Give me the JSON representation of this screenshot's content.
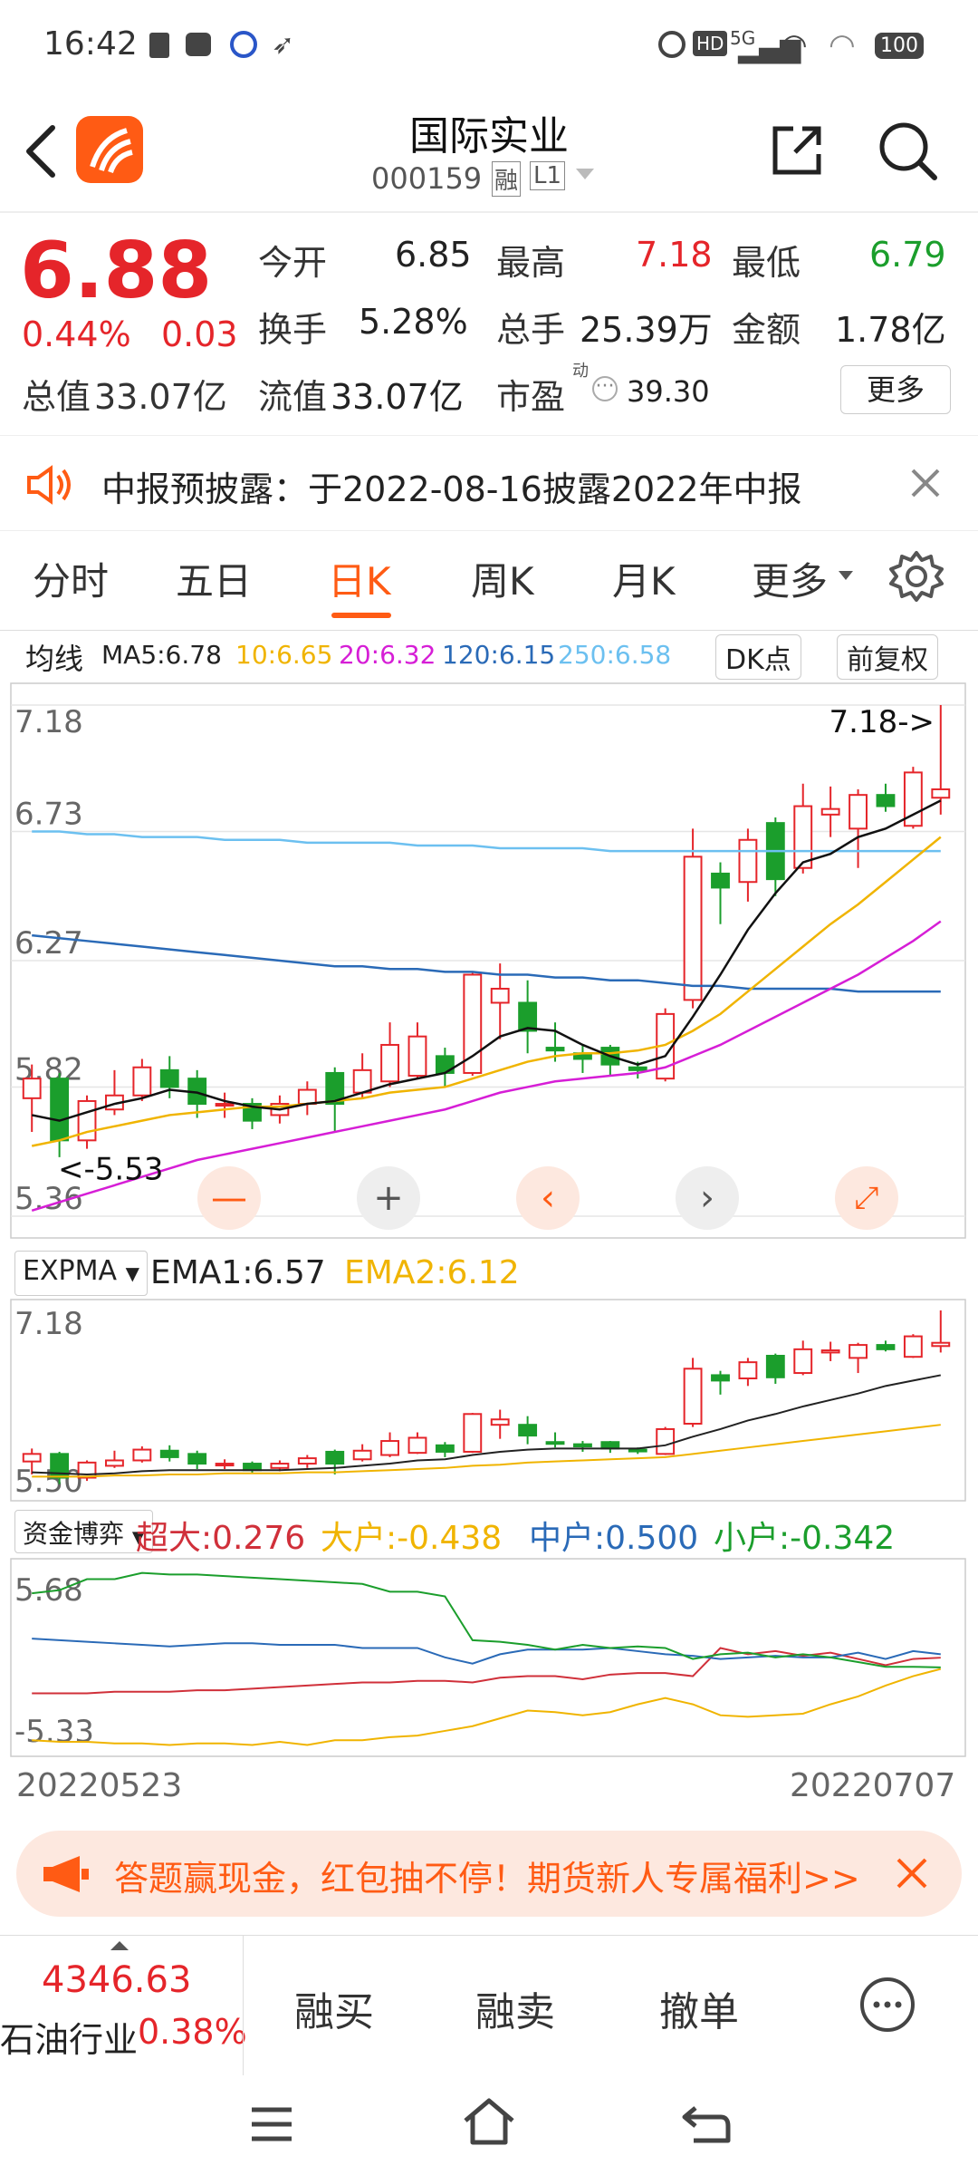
{
  "status_bar": {
    "time": "16:42",
    "network": "5G",
    "battery": "100"
  },
  "header": {
    "title": "国际实业",
    "code": "000159",
    "tag_rong": "融",
    "tag_level": "L1"
  },
  "quote": {
    "price": "6.88",
    "change_pct": "0.44%",
    "change": "0.03",
    "open_label": "今开",
    "open": "6.85",
    "high_label": "最高",
    "high": "7.18",
    "low_label": "最低",
    "low": "6.79",
    "turnover_label": "换手",
    "turnover": "5.28%",
    "volume_label": "总手",
    "volume": "25.39万",
    "amount_label": "金额",
    "amount": "1.78亿",
    "mktcap_label": "总值",
    "mktcap": "33.07亿",
    "float_label": "流值",
    "float": "33.07亿",
    "pe_label": "市盈",
    "pe_sup": "动",
    "pe": "39.30",
    "more_label": "更多"
  },
  "notice": {
    "text": "中报预披露：于2022-08-16披露2022年中报"
  },
  "tabs": [
    "分时",
    "五日",
    "日K",
    "周K",
    "月K",
    "更多"
  ],
  "ma_bar": {
    "label": "均线",
    "ma5": "MA5:6.78",
    "ma10": "10:6.65",
    "ma20": "20:6.32",
    "ma120": "120:6.15",
    "ma250": "250:6.58",
    "dk_label": "DK点",
    "adjust_label": "前复权"
  },
  "colors": {
    "up": "#e5252a",
    "down": "#1b9e2c",
    "accent": "#ff5b14",
    "ma5": "#111111",
    "ma10": "#f0b400",
    "ma20": "#d61ed6",
    "ma120": "#2a6ab7",
    "ma250": "#6cc0f0"
  },
  "chart_data": [
    {
      "type": "candlestick",
      "title": "日K",
      "x_start": "20220523",
      "x_end": "20220707",
      "ylim": [
        5.36,
        7.18
      ],
      "y_ticks": [
        "7.18",
        "6.73",
        "6.27",
        "5.82",
        "5.36"
      ],
      "max_marker": "7.18->",
      "min_marker": "5.53",
      "candles": [
        [
          5.78,
          5.85,
          5.9,
          5.66
        ],
        [
          5.85,
          5.63,
          5.87,
          5.57
        ],
        [
          5.63,
          5.77,
          5.79,
          5.6
        ],
        [
          5.74,
          5.79,
          5.88,
          5.72
        ],
        [
          5.79,
          5.89,
          5.92,
          5.77
        ],
        [
          5.88,
          5.82,
          5.93,
          5.78
        ],
        [
          5.85,
          5.76,
          5.88,
          5.71
        ],
        [
          5.76,
          5.76,
          5.8,
          5.71
        ],
        [
          5.76,
          5.7,
          5.78,
          5.67
        ],
        [
          5.72,
          5.76,
          5.79,
          5.69
        ],
        [
          5.76,
          5.81,
          5.84,
          5.72
        ],
        [
          5.87,
          5.76,
          5.89,
          5.66
        ],
        [
          5.8,
          5.88,
          5.94,
          5.78
        ],
        [
          5.84,
          5.97,
          6.05,
          5.82
        ],
        [
          5.86,
          6.0,
          6.05,
          5.85
        ],
        [
          5.93,
          5.87,
          5.96,
          5.82
        ],
        [
          5.87,
          6.22,
          6.23,
          5.86
        ],
        [
          6.12,
          6.17,
          6.26,
          5.99
        ],
        [
          6.12,
          6.02,
          6.2,
          5.94
        ],
        [
          5.96,
          5.95,
          6.05,
          5.91
        ],
        [
          5.94,
          5.92,
          5.97,
          5.87
        ],
        [
          5.96,
          5.9,
          5.97,
          5.86
        ],
        [
          5.89,
          5.88,
          5.91,
          5.85
        ],
        [
          5.85,
          6.08,
          6.1,
          5.84
        ],
        [
          6.13,
          6.64,
          6.74,
          6.1
        ],
        [
          6.58,
          6.53,
          6.62,
          6.4
        ],
        [
          6.55,
          6.7,
          6.74,
          6.48
        ],
        [
          6.76,
          6.56,
          6.78,
          6.5
        ],
        [
          6.6,
          6.82,
          6.9,
          6.58
        ],
        [
          6.79,
          6.81,
          6.89,
          6.71
        ],
        [
          6.74,
          6.86,
          6.88,
          6.6
        ],
        [
          6.86,
          6.82,
          6.9,
          6.8
        ],
        [
          6.75,
          6.94,
          6.96,
          6.74
        ],
        [
          6.85,
          6.88,
          7.18,
          6.79
        ]
      ],
      "ma5": [
        5.72,
        5.7,
        5.73,
        5.76,
        5.78,
        5.81,
        5.8,
        5.77,
        5.75,
        5.74,
        5.76,
        5.77,
        5.8,
        5.83,
        5.85,
        5.87,
        5.93,
        6.0,
        6.03,
        6.02,
        5.97,
        5.93,
        5.9,
        5.93,
        6.07,
        6.22,
        6.38,
        6.51,
        6.62,
        6.65,
        6.71,
        6.74,
        6.79,
        6.84
      ],
      "ma10": [
        5.61,
        5.63,
        5.66,
        5.68,
        5.7,
        5.72,
        5.73,
        5.74,
        5.75,
        5.75,
        5.76,
        5.77,
        5.78,
        5.8,
        5.81,
        5.82,
        5.85,
        5.88,
        5.91,
        5.93,
        5.94,
        5.94,
        5.95,
        5.97,
        6.02,
        6.08,
        6.16,
        6.24,
        6.32,
        6.4,
        6.47,
        6.55,
        6.63,
        6.71
      ],
      "ma20": [
        5.38,
        5.41,
        5.44,
        5.47,
        5.5,
        5.53,
        5.56,
        5.58,
        5.6,
        5.62,
        5.64,
        5.66,
        5.68,
        5.7,
        5.72,
        5.74,
        5.77,
        5.8,
        5.82,
        5.84,
        5.85,
        5.86,
        5.87,
        5.89,
        5.93,
        5.97,
        6.02,
        6.07,
        6.12,
        6.17,
        6.22,
        6.28,
        6.34,
        6.41
      ],
      "ma120": [
        6.36,
        6.35,
        6.34,
        6.33,
        6.32,
        6.31,
        6.3,
        6.29,
        6.28,
        6.27,
        6.26,
        6.25,
        6.25,
        6.24,
        6.24,
        6.23,
        6.23,
        6.22,
        6.22,
        6.21,
        6.21,
        6.2,
        6.2,
        6.19,
        6.18,
        6.18,
        6.17,
        6.17,
        6.17,
        6.17,
        6.16,
        6.16,
        6.16,
        6.16
      ],
      "ma250": [
        6.73,
        6.73,
        6.72,
        6.72,
        6.71,
        6.71,
        6.71,
        6.7,
        6.7,
        6.7,
        6.69,
        6.69,
        6.69,
        6.69,
        6.68,
        6.68,
        6.68,
        6.67,
        6.67,
        6.67,
        6.67,
        6.66,
        6.66,
        6.66,
        6.66,
        6.66,
        6.66,
        6.66,
        6.66,
        6.66,
        6.66,
        6.66,
        6.66,
        6.66
      ]
    },
    {
      "type": "candlestick",
      "title": "EXPMA",
      "ylim": [
        5.5,
        7.18
      ],
      "y_ticks": [
        "7.18",
        "5.50"
      ],
      "ema1_label": "EMA1:6.57",
      "ema2_label": "EMA2:6.12",
      "ema1": [
        5.68,
        5.67,
        5.66,
        5.67,
        5.69,
        5.7,
        5.7,
        5.7,
        5.7,
        5.7,
        5.71,
        5.72,
        5.74,
        5.76,
        5.79,
        5.8,
        5.84,
        5.87,
        5.89,
        5.9,
        5.9,
        5.9,
        5.9,
        5.93,
        6.01,
        6.08,
        6.16,
        6.22,
        6.29,
        6.35,
        6.41,
        6.48,
        6.53,
        6.58
      ],
      "ema2": [
        5.64,
        5.64,
        5.64,
        5.65,
        5.65,
        5.66,
        5.66,
        5.67,
        5.67,
        5.67,
        5.68,
        5.68,
        5.69,
        5.7,
        5.71,
        5.72,
        5.74,
        5.75,
        5.77,
        5.78,
        5.79,
        5.8,
        5.81,
        5.82,
        5.85,
        5.88,
        5.91,
        5.94,
        5.97,
        6.0,
        6.03,
        6.06,
        6.09,
        6.12
      ]
    },
    {
      "type": "line",
      "title": "资金博弈",
      "ylim": [
        -5.33,
        5.68
      ],
      "y_ticks": [
        "5.68",
        "-5.33"
      ],
      "x": [
        "20220523",
        "20220707"
      ],
      "series": [
        {
          "name": "超大",
          "label": "超大:0.276",
          "color": "#d0303a",
          "values": [
            -2.0,
            -2.0,
            -2.0,
            -1.9,
            -1.9,
            -1.9,
            -1.8,
            -1.8,
            -1.7,
            -1.6,
            -1.5,
            -1.4,
            -1.3,
            -1.3,
            -1.2,
            -1.2,
            -1.3,
            -1.0,
            -0.9,
            -0.9,
            -1.1,
            -0.8,
            -0.7,
            -0.7,
            -0.9,
            0.9,
            0.5,
            0.7,
            0.4,
            0.6,
            0.2,
            -0.2,
            0.2,
            0.28
          ]
        },
        {
          "name": "大户",
          "label": "大户:-0.438",
          "color": "#f0b400",
          "values": [
            -5.0,
            -5.1,
            -5.1,
            -5.2,
            -5.2,
            -5.3,
            -5.2,
            -5.2,
            -5.3,
            -5.1,
            -5.3,
            -5.0,
            -5.0,
            -4.8,
            -4.7,
            -4.4,
            -4.1,
            -3.6,
            -3.1,
            -3.2,
            -3.4,
            -3.2,
            -2.7,
            -2.3,
            -2.7,
            -3.4,
            -3.5,
            -3.4,
            -3.3,
            -2.7,
            -2.2,
            -1.5,
            -0.9,
            -0.44
          ]
        },
        {
          "name": "中户",
          "label": "中户:0.500",
          "color": "#2a6ab7",
          "values": [
            1.5,
            1.4,
            1.3,
            1.2,
            1.1,
            1.0,
            1.1,
            1.2,
            1.2,
            1.1,
            1.1,
            1.1,
            0.9,
            0.9,
            0.9,
            0.3,
            -0.1,
            0.5,
            0.8,
            0.8,
            0.8,
            0.9,
            0.7,
            0.5,
            0.4,
            0.2,
            0.3,
            0.4,
            0.3,
            0.3,
            0.6,
            0.2,
            0.7,
            0.5
          ]
        },
        {
          "name": "小户",
          "label": "小户:-0.342",
          "color": "#1b9e2c",
          "values": [
            4.4,
            4.6,
            5.3,
            5.3,
            5.7,
            5.6,
            5.6,
            5.5,
            5.4,
            5.3,
            5.2,
            5.1,
            5.0,
            4.5,
            4.5,
            4.2,
            1.4,
            1.3,
            1.1,
            0.8,
            1.1,
            0.9,
            1.0,
            0.9,
            0.2,
            0.5,
            0.6,
            0.3,
            0.5,
            0.3,
            0.0,
            -0.3,
            -0.3,
            -0.34
          ]
        }
      ]
    }
  ],
  "expma_select": "EXPMA",
  "flow_select": "资金博弈",
  "date_start": "20220523",
  "date_end": "20220707",
  "ad": {
    "text": "答题赢现金，红包抽不停！期货新人专属福利>>"
  },
  "bottom": {
    "index_value": "4346.63",
    "industry": "石油行业",
    "industry_pct": "0.38%",
    "buy": "融买",
    "sell": "融卖",
    "cancel": "撤单"
  }
}
